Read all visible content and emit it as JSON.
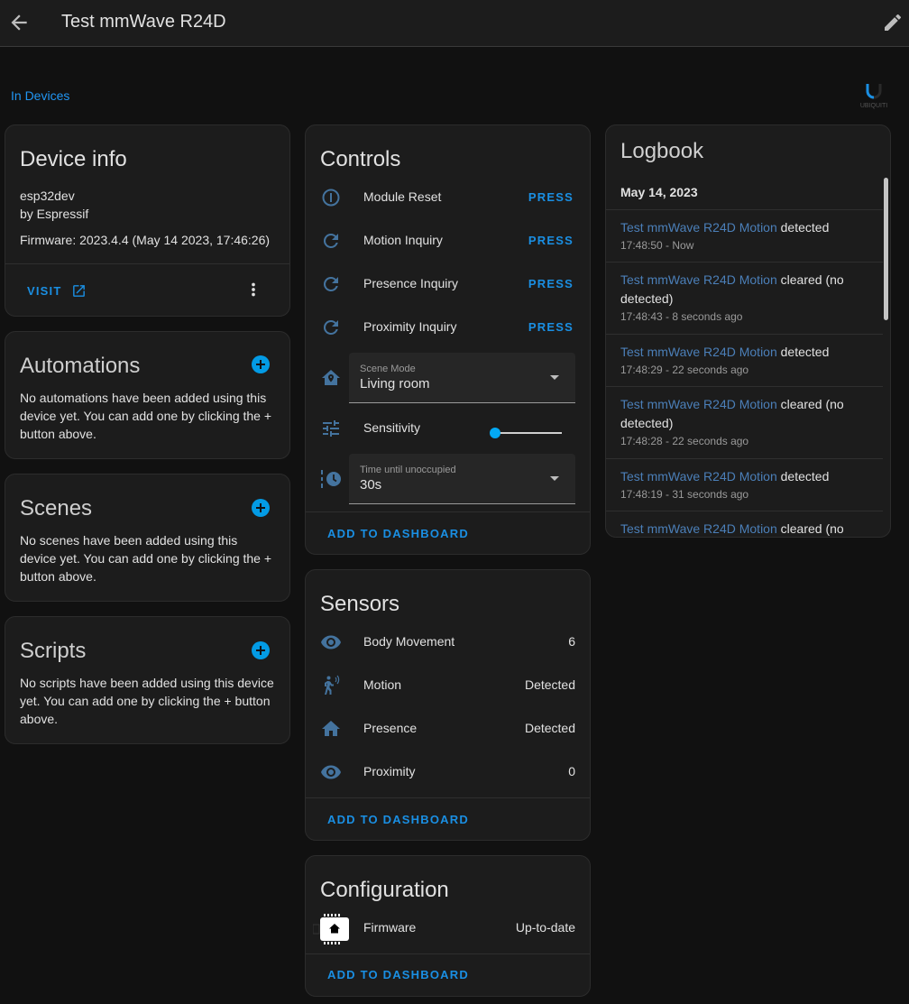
{
  "header": {
    "title": "Test mmWave R24D",
    "back_icon": "arrow-left-icon",
    "edit_icon": "pencil-icon"
  },
  "breadcrumb": {
    "label": "In Devices"
  },
  "brand": {
    "logo": "ubiquiti-logo",
    "logo_text": "UBIQUITI"
  },
  "colors": {
    "accent": "#1a8fe3",
    "icon": "#44739e",
    "entity_link": "#4b7fb8",
    "background": "#111111",
    "card": "#1c1c1c"
  },
  "device_info": {
    "title": "Device info",
    "model": "esp32dev",
    "manufacturer": "by Espressif",
    "firmware": "Firmware: 2023.4.4 (May 14 2023, 17:46:26)",
    "visit_label": "VISIT"
  },
  "automations": {
    "title": "Automations",
    "text": "No automations have been added using this device yet. You can add one by clicking the + button above."
  },
  "scenes": {
    "title": "Scenes",
    "text": "No scenes have been added using this device yet. You can add one by clicking the + button above."
  },
  "scripts": {
    "title": "Scripts",
    "text": "No scripts have been added using this device yet. You can add one by clicking the + button above."
  },
  "controls": {
    "title": "Controls",
    "buttons": [
      {
        "label": "Module Reset",
        "action": "PRESS",
        "icon": "power-circle-icon"
      },
      {
        "label": "Motion Inquiry",
        "action": "PRESS",
        "icon": "refresh-icon"
      },
      {
        "label": "Presence Inquiry",
        "action": "PRESS",
        "icon": "refresh-icon"
      },
      {
        "label": "Proximity Inquiry",
        "action": "PRESS",
        "icon": "refresh-icon"
      }
    ],
    "scene_mode": {
      "label": "Scene Mode",
      "value": "Living room",
      "icon": "home-map-marker-icon"
    },
    "sensitivity": {
      "label": "Sensitivity",
      "value_fraction": 0.0,
      "icon": "tune-icon"
    },
    "time_unoccupied": {
      "label": "Time until unoccupied",
      "value": "30s",
      "icon": "clock-timer-icon"
    },
    "add_to_dashboard": "ADD TO DASHBOARD"
  },
  "sensors": {
    "title": "Sensors",
    "items": [
      {
        "label": "Body Movement",
        "value": "6",
        "icon": "eye-icon"
      },
      {
        "label": "Motion",
        "value": "Detected",
        "icon": "motion-sensor-icon"
      },
      {
        "label": "Presence",
        "value": "Detected",
        "icon": "home-icon"
      },
      {
        "label": "Proximity",
        "value": "0",
        "icon": "eye-icon"
      }
    ],
    "add_to_dashboard": "ADD TO DASHBOARD"
  },
  "configuration": {
    "title": "Configuration",
    "items": [
      {
        "label": "Firmware",
        "value": "Up-to-date",
        "icon": "firmware-chip-icon"
      }
    ],
    "add_to_dashboard": "ADD TO DASHBOARD"
  },
  "logbook": {
    "title": "Logbook",
    "date": "May 14, 2023",
    "entries": [
      {
        "entity": "Test mmWave R24D Motion",
        "message": " detected",
        "when": "17:48:50 - Now"
      },
      {
        "entity": "Test mmWave R24D Motion",
        "message": " cleared (no detected)",
        "when": "17:48:43 - 8 seconds ago"
      },
      {
        "entity": "Test mmWave R24D Motion",
        "message": " detected",
        "when": "17:48:29 - 22 seconds ago"
      },
      {
        "entity": "Test mmWave R24D Motion",
        "message": " cleared (no detected)",
        "when": "17:48:28 - 22 seconds ago"
      },
      {
        "entity": "Test mmWave R24D Motion",
        "message": " detected",
        "when": "17:48:19 - 31 seconds ago"
      },
      {
        "entity": "Test mmWave R24D Motion",
        "message": " cleared (no",
        "when": ""
      }
    ]
  }
}
